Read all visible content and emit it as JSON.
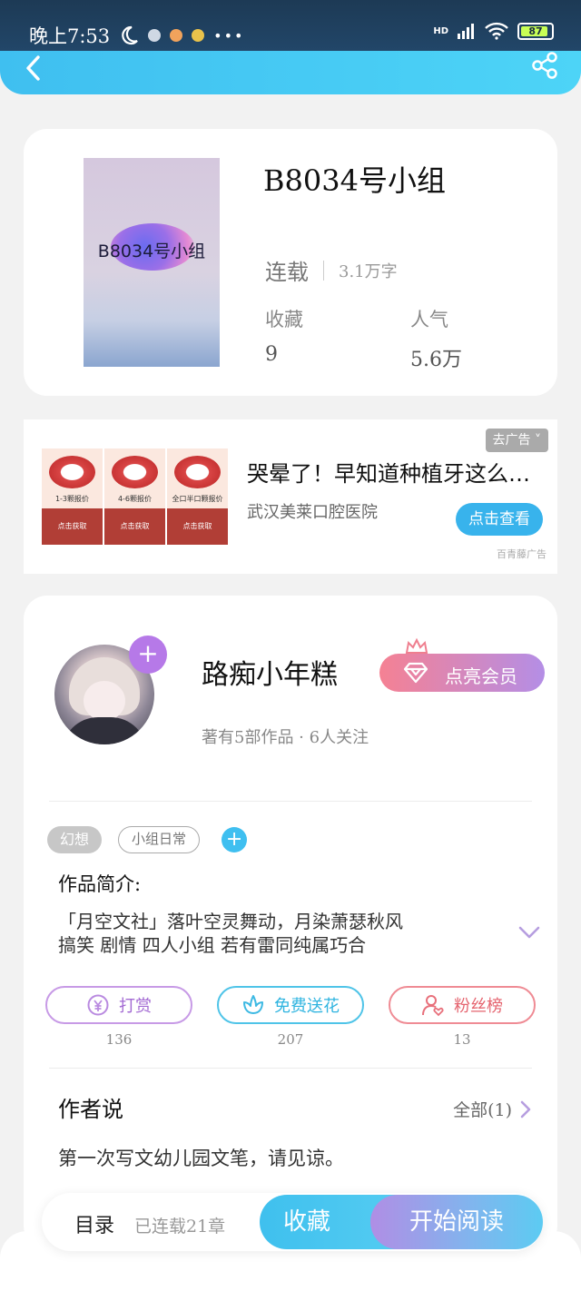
{
  "status_bar": {
    "time": "晚上7:53",
    "more": "•••",
    "network": "HD",
    "battery": "87"
  },
  "header": {
    "back_icon": "chevron-left-icon",
    "share_icon": "share-icon"
  },
  "book": {
    "cover_title": "B8034号小组",
    "title": "B8034号小组",
    "status": "连载",
    "word_count": "3.1万字",
    "favorites_label": "收藏",
    "favorites_value": "9",
    "popularity_label": "人气",
    "popularity_value": "5.6万"
  },
  "ad": {
    "images": [
      {
        "caption": "1-3颗报价",
        "button": "点击获取"
      },
      {
        "caption": "4-6颗报价",
        "button": "点击获取"
      },
      {
        "caption": "全口半口颗报价",
        "button": "点击获取"
      }
    ],
    "title": "哭晕了！早知道种植牙这么…",
    "source": "武汉美莱口腔医院",
    "close_label": "去广告 ˅",
    "cta_label": "点击查看",
    "brand": "百青藤广告"
  },
  "author": {
    "name": "路痴小年糕",
    "meta": "著有5部作品 · 6人关注",
    "vip_label": "点亮会员",
    "plus": "+"
  },
  "tags": {
    "items": [
      "幻想",
      "小组日常"
    ],
    "add": "+"
  },
  "intro": {
    "heading": "作品简介:",
    "line1": "「月空文社」落叶空灵舞动，月染萧瑟秋风",
    "line2": "搞笑 剧情 四人小组 若有雷同纯属巧合"
  },
  "actions": [
    {
      "label": "打赏",
      "count": "136",
      "icon": "yen-coin-icon",
      "color": "#a36ad3"
    },
    {
      "label": "免费送花",
      "count": "207",
      "icon": "flower-icon",
      "color": "#2fb4e0"
    },
    {
      "label": "粉丝榜",
      "count": "13",
      "icon": "user-heart-icon",
      "color": "#e5646f"
    }
  ],
  "author_says": {
    "heading": "作者说",
    "all_label": "全部(1)",
    "text": "第一次写文幼儿园文笔，请见谅。"
  },
  "bottom_bar": {
    "toc_label": "目录",
    "chapters": "已连载21章",
    "favorite_label": "收藏",
    "read_label": "开始阅读"
  }
}
